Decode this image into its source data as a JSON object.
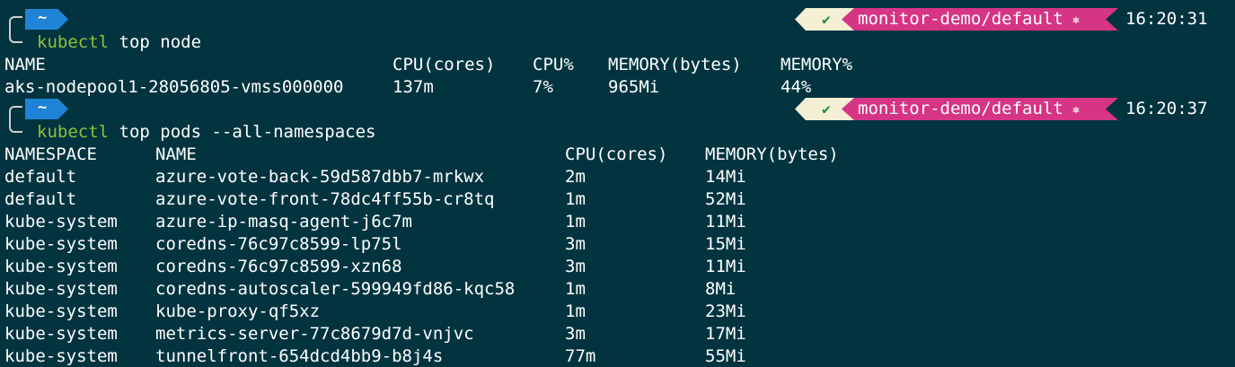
{
  "prompt": {
    "dir": "~",
    "check": "✔",
    "context": "monitor-demo/default",
    "k8s_icon": "⎈"
  },
  "blocks": [
    {
      "time": "16:20:31",
      "cmd_name": "kubectl",
      "cmd_args": " top node"
    },
    {
      "time": "16:20:37",
      "cmd_name": "kubectl",
      "cmd_args": " top pods --all-namespaces"
    }
  ],
  "node_table": {
    "headers": [
      "NAME",
      "CPU(cores)",
      "CPU%",
      "MEMORY(bytes)",
      "MEMORY%"
    ],
    "rows": [
      [
        "aks-nodepool1-28056805-vmss000000",
        "137m",
        "7%",
        "965Mi",
        "44%"
      ]
    ]
  },
  "pods_table": {
    "headers": [
      "NAMESPACE",
      "NAME",
      "CPU(cores)",
      "MEMORY(bytes)"
    ],
    "rows": [
      [
        "default",
        "azure-vote-back-59d587dbb7-mrkwx",
        "2m",
        "14Mi"
      ],
      [
        "default",
        "azure-vote-front-78dc4ff55b-cr8tq",
        "1m",
        "52Mi"
      ],
      [
        "kube-system",
        "azure-ip-masq-agent-j6c7m",
        "1m",
        "11Mi"
      ],
      [
        "kube-system",
        "coredns-76c97c8599-lp75l",
        "3m",
        "15Mi"
      ],
      [
        "kube-system",
        "coredns-76c97c8599-xzn68",
        "3m",
        "11Mi"
      ],
      [
        "kube-system",
        "coredns-autoscaler-599949fd86-kqc58",
        "1m",
        "8Mi"
      ],
      [
        "kube-system",
        "kube-proxy-qf5xz",
        "1m",
        "23Mi"
      ],
      [
        "kube-system",
        "metrics-server-77c8679d7d-vnjvc",
        "3m",
        "17Mi"
      ],
      [
        "kube-system",
        "tunnelfront-654dcd4bb9-b8j4s",
        "77m",
        "55Mi"
      ]
    ]
  }
}
